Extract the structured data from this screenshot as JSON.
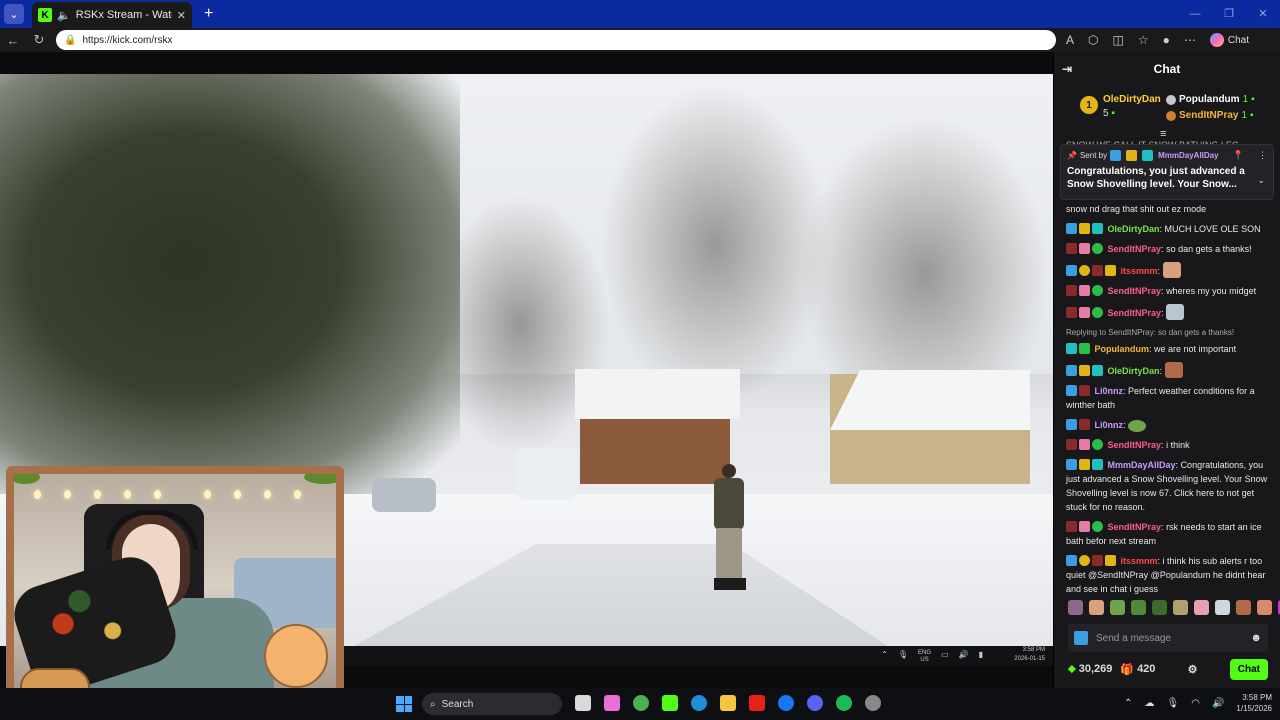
{
  "browser": {
    "tab_title": "RSKx Stream - Watch Live on Kick",
    "tab_logo": "K",
    "url": "https://kick.com/rskx",
    "chat_label": "Chat",
    "new_tab": "+"
  },
  "video": {
    "taskbar_lang": "ENG",
    "taskbar_region": "US",
    "taskbar_time": "3:58 PM",
    "taskbar_date": "2026-01-15"
  },
  "chat": {
    "title": "Chat",
    "top_gifters": [
      {
        "rank": "1",
        "name": "OleDirtyDan",
        "count": "5"
      },
      {
        "name": "Populandum",
        "count": "1"
      },
      {
        "name": "SendItNPray",
        "count": "1"
      }
    ],
    "cut_line": "SNOW WE CALL IT SNOW BATHING LEG",
    "pinned": {
      "sent_by": "Sent by",
      "user": "MmmDayAllDay",
      "text": "Congratulations, you just advanced a Snow Shovelling level. Your Snow..."
    },
    "messages": [
      {
        "user": "",
        "text": "snow nd drag that shit out ez mode"
      },
      {
        "user": "OleDirtyDan",
        "color": "#7fe04a",
        "text": "MUCH LOVE OLE SON"
      },
      {
        "user": "SendItNPray",
        "color": "#ff5c8a",
        "text": "so dan gets a thanks!"
      },
      {
        "user": "itssmnm",
        "color": "#ff4a4a",
        "text": ""
      },
      {
        "user": "SendItNPray",
        "color": "#ff5c8a",
        "text": "wheres my you midget"
      },
      {
        "user": "SendItNPray",
        "color": "#ff5c8a",
        "text": ""
      },
      {
        "reply": "Replying to SendItNPray: so dan gets a thanks!",
        "user": "Populandum",
        "color": "#f5b63b",
        "text": "we are not important"
      },
      {
        "user": "OleDirtyDan",
        "color": "#7fe04a",
        "text": ""
      },
      {
        "user": "Li0nnz",
        "color": "#c79bff",
        "text": "Perfect weather conditions for a winther bath"
      },
      {
        "user": "Li0nnz",
        "color": "#c79bff",
        "text": ""
      },
      {
        "user": "SendItNPray",
        "color": "#ff5c8a",
        "text": "i think"
      },
      {
        "user": "MmmDayAllDay",
        "color": "#c79bff",
        "text": "Congratulations, you just advanced a Snow Shovelling level. Your Snow Shovelling level is now 67. Click here to not get stuck for no reason."
      },
      {
        "user": "SendItNPray",
        "color": "#ff5c8a",
        "text": "rsk needs to start an ice bath befor next stream"
      },
      {
        "user": "itssmnm",
        "color": "#ff4a4a",
        "text": "i think his sub alerts r too quiet @SendItNPray @Populandum he didnt hear and see in chat i guess"
      }
    ],
    "input_placeholder": "Send a message",
    "points": "30,269",
    "gifts": "420",
    "send_label": "Chat"
  },
  "taskbar": {
    "search": "Search",
    "time": "3:58 PM",
    "date": "1/15/2026"
  }
}
